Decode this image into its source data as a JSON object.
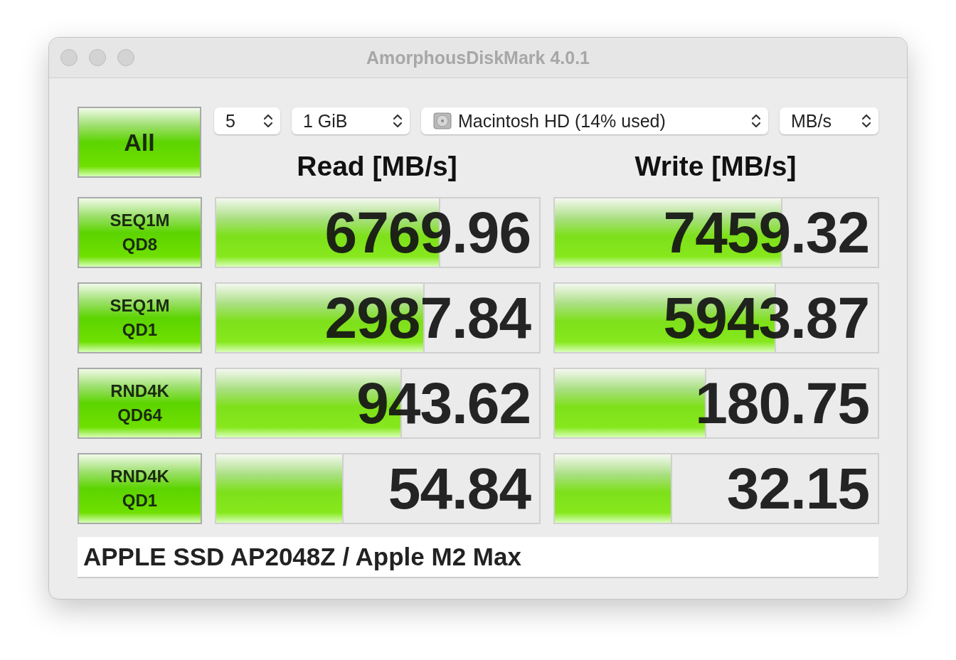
{
  "window": {
    "title": "AmorphousDiskMark 4.0.1"
  },
  "all_button": {
    "label": "All"
  },
  "settings": [
    {
      "kind": "count",
      "value": "5"
    },
    {
      "kind": "size",
      "value": "1 GiB"
    },
    {
      "kind": "drive",
      "value": "Macintosh HD (14% used)"
    },
    {
      "kind": "unit",
      "value": "MB/s"
    }
  ],
  "columns": [
    "Read [MB/s]",
    "Write [MB/s]"
  ],
  "rows": [
    {
      "label": [
        "SEQ1M",
        "QD8"
      ],
      "read": {
        "value": "6769.96",
        "level": 0.69
      },
      "write": {
        "value": "7459.32",
        "level": 0.7
      }
    },
    {
      "label": [
        "SEQ1M",
        "QD1"
      ],
      "read": {
        "value": "2987.84",
        "level": 0.64
      },
      "write": {
        "value": "5943.87",
        "level": 0.68
      }
    },
    {
      "label": [
        "RND4K",
        "QD64"
      ],
      "read": {
        "value": "943.62",
        "level": 0.57
      },
      "write": {
        "value": "180.75",
        "level": 0.465
      }
    },
    {
      "label": [
        "RND4K",
        "QD1"
      ],
      "read": {
        "value": "54.84",
        "level": 0.39
      },
      "write": {
        "value": "32.15",
        "level": 0.36
      }
    }
  ],
  "footer": {
    "text": "APPLE SSD AP2048Z / Apple M2 Max"
  }
}
